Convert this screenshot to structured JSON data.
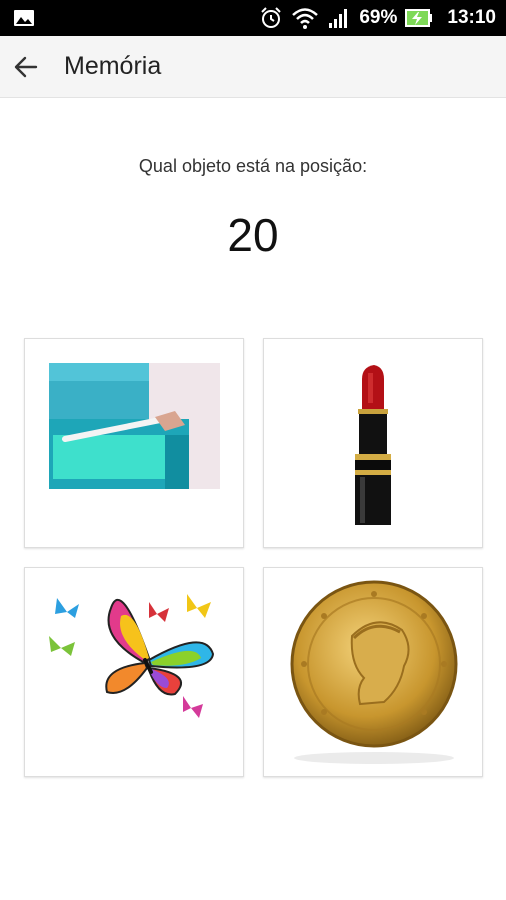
{
  "status_bar": {
    "battery_percent": "69%",
    "time": "13:10",
    "icons": [
      "gallery-icon",
      "alarm-icon",
      "wifi-icon",
      "signal-icon",
      "battery-charging-icon"
    ]
  },
  "toolbar": {
    "back_icon": "arrow-left-icon",
    "title": "Memória"
  },
  "game": {
    "question": "Qual objeto está na posição:",
    "position_number": "20",
    "options": [
      {
        "id": "option-container",
        "icon": "plastic-container-icon"
      },
      {
        "id": "option-lipstick",
        "icon": "lipstick-icon"
      },
      {
        "id": "option-butterflies",
        "icon": "butterflies-icon"
      },
      {
        "id": "option-gold-coin",
        "icon": "gold-coin-icon"
      }
    ]
  },
  "colors": {
    "status_bar_bg": "#000000",
    "toolbar_bg": "#f5f5f5",
    "card_border": "#dddddd"
  }
}
